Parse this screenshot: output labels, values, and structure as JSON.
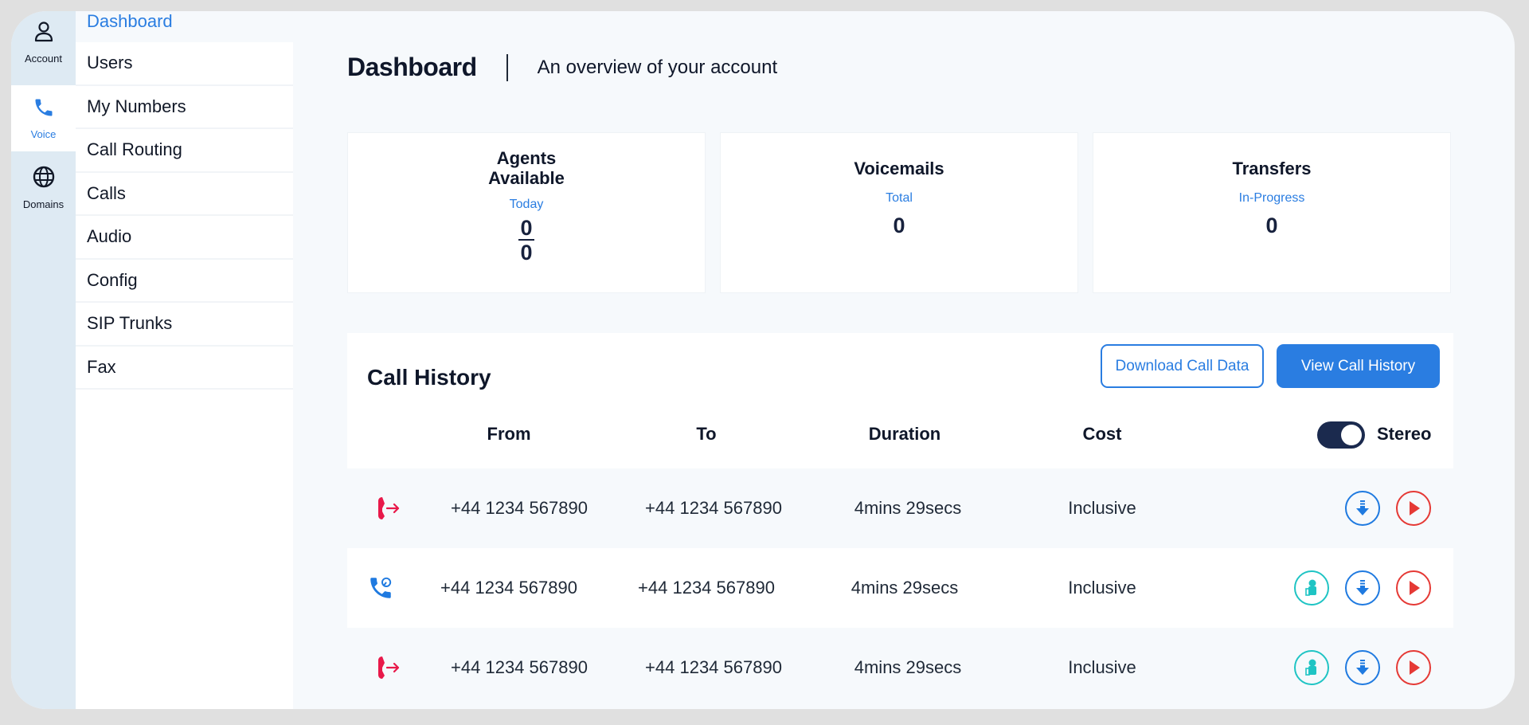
{
  "rail": {
    "items": [
      {
        "label": "Account",
        "icon": "user-icon",
        "active": false
      },
      {
        "label": "Voice",
        "icon": "phone-icon",
        "active": true
      },
      {
        "label": "Domains",
        "icon": "globe-icon",
        "active": false
      }
    ]
  },
  "subnav": {
    "title": "Dashboard",
    "items": [
      "Users",
      "My Numbers",
      "Call Routing",
      "Calls",
      "Audio",
      "Config",
      "SIP Trunks",
      "Fax"
    ]
  },
  "header": {
    "title": "Dashboard",
    "subtitle": "An overview of your account"
  },
  "stats": {
    "agents": {
      "title_line1": "Agents",
      "title_line2": "Available",
      "sub": "Today",
      "numerator": "0",
      "denominator": "0"
    },
    "voicemails": {
      "title": "Voicemails",
      "sub": "Total",
      "value": "0"
    },
    "transfers": {
      "title": "Transfers",
      "sub": "In-Progress",
      "value": "0"
    }
  },
  "history": {
    "title": "Call History",
    "download_label": "Download Call Data",
    "view_label": "View Call History",
    "columns": {
      "from": "From",
      "to": "To",
      "duration": "Duration",
      "cost": "Cost"
    },
    "stereo_label": "Stereo",
    "stereo_on": true,
    "colors": {
      "outbound": "#e8194a",
      "inbound": "#1f7ae0",
      "record": "#1fc4c4",
      "download": "#1f7ae0",
      "play": "#e53935",
      "accent": "#2a7de1"
    },
    "rows": [
      {
        "direction": "outbound",
        "from": "+44 1234 567890",
        "to": "+44 1234 567890",
        "duration": "4mins 29secs",
        "cost": "Inclusive",
        "has_recording": false
      },
      {
        "direction": "inbound",
        "from": "+44 1234 567890",
        "to": "+44 1234 567890",
        "duration": "4mins 29secs",
        "cost": "Inclusive",
        "has_recording": true
      },
      {
        "direction": "outbound",
        "from": "+44 1234 567890",
        "to": "+44 1234 567890",
        "duration": "4mins 29secs",
        "cost": "Inclusive",
        "has_recording": true
      }
    ]
  }
}
